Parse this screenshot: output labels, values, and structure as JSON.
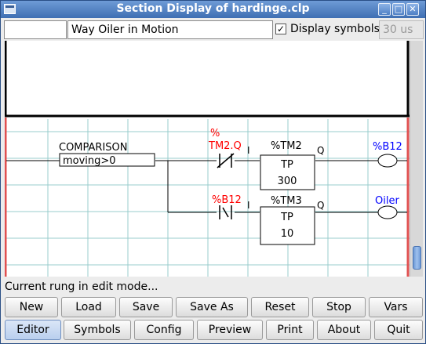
{
  "window": {
    "title": "Section Display of hardinge.clp"
  },
  "toolbar": {
    "section_name": "",
    "comment": "Way Oiler in Motion",
    "display_symbols_label": "Display symbols",
    "display_symbols_checked": "✓",
    "cycle_time": "30 us"
  },
  "ladder": {
    "comparison_label": "COMPARISON",
    "comparison_expr": "moving>0",
    "rung1": {
      "contact_label_line1": "%",
      "contact_label_line2": "TM2.Q",
      "timer_name": "%TM2",
      "input_label": "I",
      "output_label": "Q",
      "timer_type": "TP",
      "timer_preset": "300",
      "coil_label": "%B12"
    },
    "rung2": {
      "contact_label": "%B12",
      "timer_name": "%TM3",
      "input_label": "I",
      "output_label": "Q",
      "timer_type": "TP",
      "timer_preset": "10",
      "coil_label": "Oiler"
    },
    "colors": {
      "red": "#ff0000",
      "blue": "#0000ff",
      "grid": "#99cccc",
      "rail": "#e05050"
    }
  },
  "status_text": "Current rung in edit mode...",
  "buttons_row1": [
    "New",
    "Load",
    "Save",
    "Save As",
    "Reset",
    "Stop",
    "Vars"
  ],
  "buttons_row2": [
    "Editor",
    "Symbols",
    "Config",
    "Preview",
    "Print",
    "About",
    "Quit"
  ]
}
